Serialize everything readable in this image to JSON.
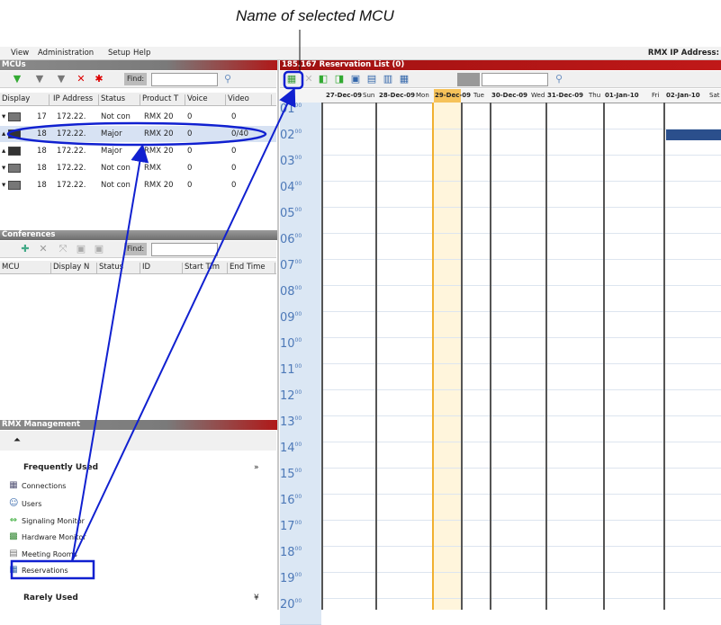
{
  "callout": "Name of selected MCU",
  "menu": [
    "View",
    "Administration",
    "Setup",
    "Help"
  ],
  "rmx_ip_label": "RMX IP Address:",
  "mcus": {
    "title": "MCUs",
    "find_label": "Find:",
    "columns": [
      "Display",
      "IP Address",
      "Status",
      "Product T",
      "Voice",
      "Video"
    ],
    "rows": [
      {
        "arrow": "▾",
        "display": "17",
        "ip": "172.22.",
        "status": "Not con",
        "product": "RMX 20",
        "voice": "0",
        "video": "0"
      },
      {
        "arrow": "▴",
        "display": "18",
        "ip": "172.22.",
        "status": "Major",
        "product": "RMX 20",
        "voice": "0",
        "video": "0/40"
      },
      {
        "arrow": "▴",
        "display": "18",
        "ip": "172.22.",
        "status": "Major",
        "product": "RMX 20",
        "voice": "0",
        "video": "0"
      },
      {
        "arrow": "▾",
        "display": "18",
        "ip": "172.22.",
        "status": "Not con",
        "product": "RMX",
        "voice": "0",
        "video": "0"
      },
      {
        "arrow": "▾",
        "display": "18",
        "ip": "172.22.",
        "status": "Not con",
        "product": "RMX 20",
        "voice": "0",
        "video": "0"
      }
    ]
  },
  "conferences": {
    "title": "Conferences",
    "find_label": "Find:",
    "columns": [
      "MCU",
      "Display N",
      "Status",
      "ID",
      "Start Tim",
      "End Time"
    ]
  },
  "management": {
    "title": "RMX Management",
    "frequently_used": "Frequently Used",
    "items": [
      "Connections",
      "Users",
      "Signaling Monitor",
      "Hardware Monitor",
      "Meeting Rooms",
      "Reservations"
    ],
    "rarely_used": "Rarely Used"
  },
  "reservation": {
    "title": "185.167 Reservation List (0)",
    "days": [
      "27-Dec-09",
      "Sun",
      "28-Dec-09",
      "Mon",
      "29-Dec-09",
      "Tue",
      "30-Dec-09",
      "Wed",
      "31-Dec-09",
      "Thu",
      "01-Jan-10",
      "Fri",
      "02-Jan-10",
      "Sat"
    ],
    "hours": [
      "01",
      "02",
      "03",
      "04",
      "05",
      "06",
      "07",
      "08",
      "09",
      "10",
      "11",
      "12",
      "13",
      "14",
      "15",
      "16",
      "17",
      "18",
      "19",
      "20"
    ],
    "minutes": "00"
  },
  "colors": {
    "accent_red": "#b01818",
    "highlight": "#d7e2f3",
    "annotation_blue": "#1020d0",
    "today": "#f6c25a"
  }
}
